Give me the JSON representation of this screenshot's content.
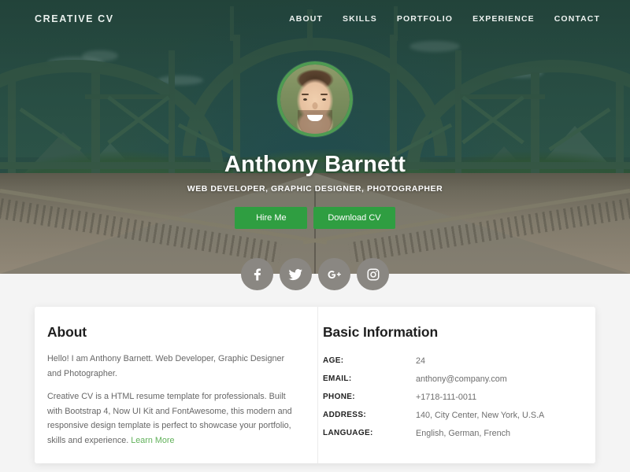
{
  "navbar": {
    "brand": "CREATIVE CV",
    "links": [
      {
        "label": "ABOUT"
      },
      {
        "label": "SKILLS"
      },
      {
        "label": "PORTFOLIO"
      },
      {
        "label": "EXPERIENCE"
      },
      {
        "label": "CONTACT"
      }
    ]
  },
  "hero": {
    "name": "Anthony Barnett",
    "role": "WEB DEVELOPER, GRAPHIC DESIGNER, PHOTOGRAPHER",
    "primary_button": "Hire Me",
    "secondary_button": "Download CV",
    "avatar_alt": "profile-photo"
  },
  "socials": [
    {
      "name": "facebook",
      "icon": "facebook-icon"
    },
    {
      "name": "twitter",
      "icon": "twitter-icon"
    },
    {
      "name": "google-plus",
      "icon": "google-plus-icon"
    },
    {
      "name": "instagram",
      "icon": "instagram-icon"
    }
  ],
  "about": {
    "title": "About",
    "paragraph1": "Hello! I am Anthony Barnett. Web Developer, Graphic Designer and Photographer.",
    "paragraph2": "Creative CV is a HTML resume template for professionals. Built with Bootstrap 4, Now UI Kit and FontAwesome, this modern and responsive design template is perfect to showcase your portfolio, skills and experience. ",
    "link": "Learn More"
  },
  "basic_information": {
    "title": "Basic Information",
    "rows": [
      {
        "label": "AGE:",
        "value": "24"
      },
      {
        "label": "EMAIL:",
        "value": "anthony@company.com"
      },
      {
        "label": "PHONE:",
        "value": "+1718-111-0011"
      },
      {
        "label": "ADDRESS:",
        "value": "140, City Center, New York, U.S.A"
      },
      {
        "label": "LANGUAGE:",
        "value": "English, German, French"
      }
    ]
  },
  "colors": {
    "accent_green": "#2f9e41",
    "hero_dark": "#2b4f47",
    "link_green": "#61b15a",
    "social_gray": "#8a8782",
    "avatar_ring": "#4e9b52"
  }
}
